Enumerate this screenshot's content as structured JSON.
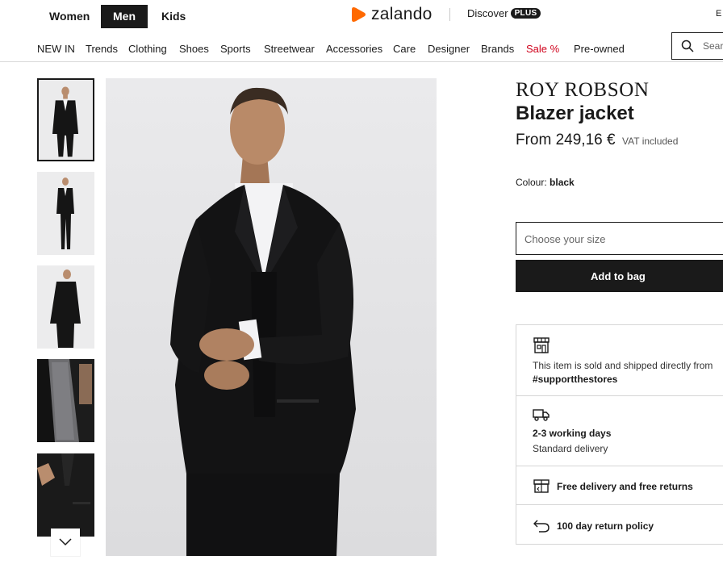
{
  "header": {
    "genders": [
      "Women",
      "Men",
      "Kids"
    ],
    "active_gender": "Men",
    "logo_text": "zalando",
    "discover_label": "Discover",
    "plus_badge": "PLUS",
    "language": "E"
  },
  "nav": {
    "items": [
      "NEW IN",
      "Trends",
      "Clothing",
      "Shoes",
      "Sports",
      "Streetwear",
      "Accessories",
      "Care",
      "Designer",
      "Brands",
      "Sale %",
      "Pre-owned"
    ],
    "search_placeholder": "Sear"
  },
  "gallery": {
    "thumbnail_count": 5,
    "selected_index": 0
  },
  "product": {
    "brand": "ROY ROBSON",
    "name": "Blazer jacket",
    "price": "From 249,16 €",
    "vat_note": "VAT included",
    "colour_label": "Colour:",
    "colour_value": "black",
    "size_placeholder": "Choose your size",
    "add_to_bag": "Add to bag"
  },
  "info": {
    "store_line1": "This item is sold and shipped directly from",
    "store_line2": "#supportthestores",
    "delivery_days": "2-3 working days",
    "delivery_type": "Standard delivery",
    "free_delivery": "Free delivery and free returns",
    "return_policy": "100 day return policy"
  },
  "colors": {
    "accent_orange": "#ff6900",
    "sale_red": "#d0011b",
    "dark": "#1a1a1a"
  }
}
